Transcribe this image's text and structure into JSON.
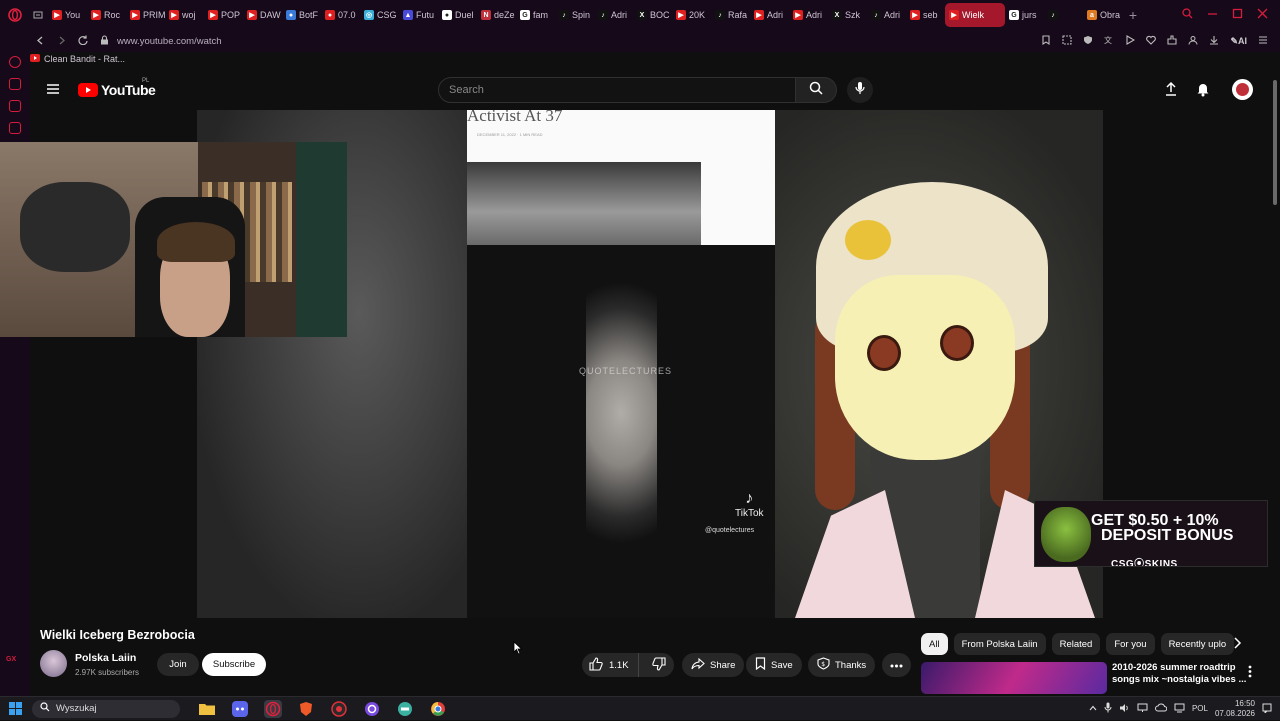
{
  "browser": {
    "tabs": [
      {
        "label": "You",
        "color": "#e02020",
        "glyph": "▶"
      },
      {
        "label": "Roc",
        "color": "#e02020",
        "glyph": "▶"
      },
      {
        "label": "PRIM",
        "color": "#e02020",
        "glyph": "▶"
      },
      {
        "label": "woj",
        "color": "#e02020",
        "glyph": "▶"
      },
      {
        "label": "POP",
        "color": "#e02020",
        "glyph": "▶"
      },
      {
        "label": "DAW",
        "color": "#e02020",
        "glyph": "▶"
      },
      {
        "label": "BotF",
        "color": "#3a7ad8",
        "glyph": "●"
      },
      {
        "label": "07.0",
        "color": "#e02020",
        "glyph": "●"
      },
      {
        "label": "CSG",
        "color": "#3ab0d8",
        "glyph": "◎"
      },
      {
        "label": "Futu",
        "color": "#4a4ad8",
        "glyph": "▲"
      },
      {
        "label": "Duel",
        "color": "#ffffff",
        "glyph": "●"
      },
      {
        "label": "deZe",
        "color": "#c0303a",
        "glyph": "N"
      },
      {
        "label": "fam",
        "color": "#ffffff",
        "glyph": "G"
      },
      {
        "label": "Spin",
        "color": "#111111",
        "glyph": "♪"
      },
      {
        "label": "Adri",
        "color": "#111111",
        "glyph": "♪"
      },
      {
        "label": "BOC",
        "color": "#111111",
        "glyph": "X"
      },
      {
        "label": "20K",
        "color": "#e02020",
        "glyph": "▶"
      },
      {
        "label": "Rafa",
        "color": "#111111",
        "glyph": "♪"
      },
      {
        "label": "Adri",
        "color": "#e02020",
        "glyph": "▶"
      },
      {
        "label": "Adri",
        "color": "#e02020",
        "glyph": "▶"
      },
      {
        "label": "Szk",
        "color": "#111111",
        "glyph": "X"
      },
      {
        "label": "Adri",
        "color": "#111111",
        "glyph": "♪"
      },
      {
        "label": "seb",
        "color": "#e02020",
        "glyph": "▶"
      },
      {
        "label": "Wielk",
        "color": "#e02020",
        "glyph": "▶",
        "active": true
      },
      {
        "label": "jurs",
        "color": "#ffffff",
        "glyph": "G"
      },
      {
        "label": "",
        "color": "#111111",
        "glyph": "♪"
      },
      {
        "label": "Obra",
        "color": "#e07a20",
        "glyph": "a"
      }
    ],
    "url": "www.youtube.com/watch",
    "bookmark": "Clean Bandit - Rat...",
    "sidebar_label": "GX"
  },
  "youtube": {
    "logo_text": "YouTube",
    "country": "PL",
    "search_placeholder": "Search"
  },
  "player": {
    "article_title": "Activist At 37",
    "article_meta": "DECEMBER 11, 2022 · 1 MIN READ",
    "watermark": "QUOTELECTURES",
    "tiktok_label": "TikTok",
    "tiktok_handle": "@quotelectures"
  },
  "ad": {
    "line1": "GET $0.50 + 10%",
    "line2": "DEPOSIT BONUS",
    "brand": "CSG⦿SKINS"
  },
  "video": {
    "title": "Wielki Iceberg Bezrobocia",
    "channel": "Polska Laiin",
    "subscribers": "2.97K subscribers",
    "join": "Join",
    "subscribe": "Subscribe",
    "likes": "1.1K",
    "share": "Share",
    "save": "Save",
    "thanks": "Thanks"
  },
  "chips": [
    "All",
    "From Polska Laiin",
    "Related",
    "For you",
    "Recently uplo"
  ],
  "related": {
    "title": "2010-2026 summer roadtrip songs mix ~nostalgia vibes ..."
  },
  "taskbar": {
    "search_placeholder": "Wyszukaj",
    "language": "POL",
    "time": "16:50",
    "date": "07.08.2026"
  }
}
